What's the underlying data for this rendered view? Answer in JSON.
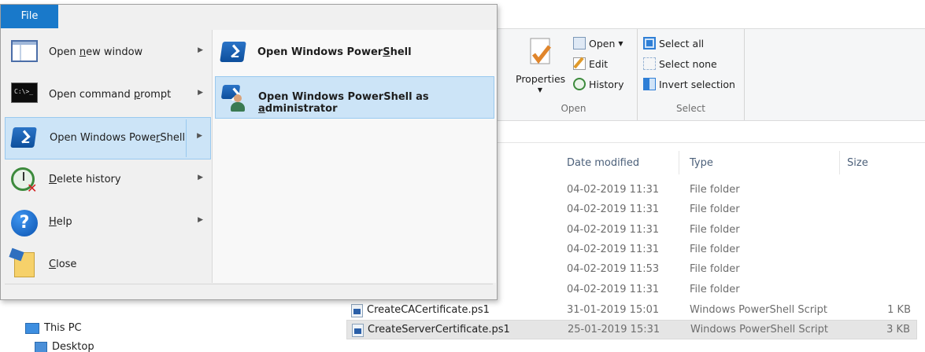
{
  "file_tab": {
    "label": "File"
  },
  "file_menu": {
    "items": [
      {
        "label_pre": "Open ",
        "label_u": "n",
        "label_post": "ew window",
        "icon": "window-icon",
        "has_submenu": true
      },
      {
        "label_pre": "Open command ",
        "label_u": "p",
        "label_post": "rompt",
        "icon": "command-prompt-icon",
        "has_submenu": true
      },
      {
        "label_pre": "Open Windows Powe",
        "label_u": "r",
        "label_post": "Shell",
        "icon": "powershell-icon",
        "has_submenu": true,
        "active": true
      },
      {
        "label_pre": "",
        "label_u": "D",
        "label_post": "elete history",
        "icon": "delete-history-icon",
        "has_submenu": true
      },
      {
        "label_pre": "",
        "label_u": "H",
        "label_post": "elp",
        "icon": "help-icon",
        "has_submenu": true
      },
      {
        "label_pre": "",
        "label_u": "C",
        "label_post": "lose",
        "icon": "close-icon",
        "has_submenu": false
      }
    ],
    "cmd_icon_text": "C:\\>_"
  },
  "submenu": {
    "items": [
      {
        "label_pre": "Open Windows Power",
        "label_u": "S",
        "label_post": "hell",
        "icon": "powershell-icon"
      },
      {
        "label_pre": "Open Windows PowerShell as ",
        "label_u": "a",
        "label_post": "dministrator",
        "icon": "powershell-admin-icon",
        "hover": true
      }
    ]
  },
  "ribbon": {
    "open_group": {
      "title": "Open",
      "properties_label": "Properties",
      "open_label": "Open",
      "edit_label": "Edit",
      "history_label": "History"
    },
    "select_group": {
      "title": "Select",
      "select_all": "Select all",
      "select_none": "Select none",
      "invert_selection": "Invert selection"
    }
  },
  "file_list": {
    "columns": {
      "date": "Date modified",
      "type": "Type",
      "size": "Size"
    },
    "rows": [
      {
        "name": "",
        "date": "04-02-2019 11:31",
        "type": "File folder",
        "size": ""
      },
      {
        "name": "",
        "date": "04-02-2019 11:31",
        "type": "File folder",
        "size": ""
      },
      {
        "name": "",
        "date": "04-02-2019 11:31",
        "type": "File folder",
        "size": ""
      },
      {
        "name": "",
        "date": "04-02-2019 11:31",
        "type": "File folder",
        "size": ""
      },
      {
        "name": "",
        "date": "04-02-2019 11:53",
        "type": "File folder",
        "size": ""
      },
      {
        "name": "",
        "date": "04-02-2019 11:31",
        "type": "File folder",
        "size": ""
      },
      {
        "name": "CreateCACertificate.ps1",
        "date": "31-01-2019 15:01",
        "type": "Windows PowerShell Script",
        "size": "1 KB"
      },
      {
        "name": "CreateServerCertificate.ps1",
        "date": "25-01-2019 15:31",
        "type": "Windows PowerShell Script",
        "size": "3 KB",
        "selected": true
      }
    ]
  },
  "nav_pane": {
    "this_pc": "This PC",
    "desktop": "Desktop"
  }
}
